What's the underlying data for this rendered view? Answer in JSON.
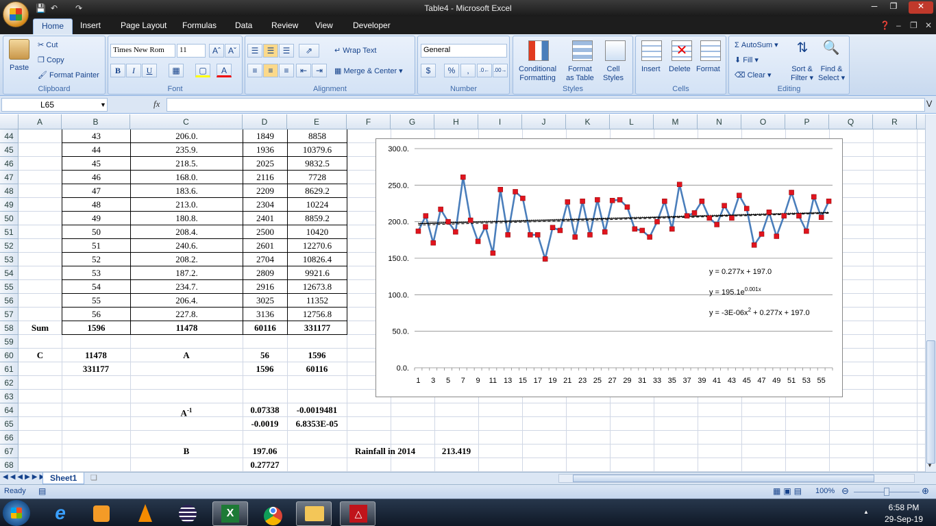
{
  "window": {
    "title": "Table4 - Microsoft Excel"
  },
  "tabs": [
    "Home",
    "Insert",
    "Page Layout",
    "Formulas",
    "Data",
    "Review",
    "View",
    "Developer"
  ],
  "active_tab": "Home",
  "ribbon": {
    "clipboard": {
      "label": "Clipboard",
      "paste": "Paste",
      "cut": "Cut",
      "copy": "Copy",
      "format_painter": "Format Painter"
    },
    "font": {
      "label": "Font",
      "font_name": "Times New Rom",
      "font_size": "11",
      "bold": "B",
      "italic": "I",
      "underline": "U"
    },
    "alignment": {
      "label": "Alignment",
      "wrap_text": "Wrap Text",
      "merge_center": "Merge & Center"
    },
    "number": {
      "label": "Number",
      "format": "General",
      "currency": "$",
      "percent": "%",
      "comma": ","
    },
    "styles": {
      "label": "Styles",
      "conditional": "Conditional",
      "formatting": "Formatting",
      "format_as": "Format",
      "as_table": "as Table",
      "cell": "Cell",
      "cell_styles": "Styles"
    },
    "cells": {
      "label": "Cells",
      "insert": "Insert",
      "delete": "Delete",
      "format": "Format"
    },
    "editing": {
      "label": "Editing",
      "autosum": "AutoSum",
      "fill": "Fill",
      "clear": "Clear",
      "sort": "Sort &",
      "filter": "Filter",
      "find": "Find &",
      "select": "Select"
    }
  },
  "formula_bar": {
    "name_box": "L65",
    "fx": "fx",
    "content": ""
  },
  "columns": [
    "A",
    "B",
    "C",
    "D",
    "E",
    "F",
    "G",
    "H",
    "I",
    "J",
    "K",
    "L",
    "M",
    "N",
    "O",
    "P",
    "Q",
    "R"
  ],
  "rows": [
    "44",
    "45",
    "46",
    "47",
    "48",
    "49",
    "50",
    "51",
    "52",
    "53",
    "54",
    "55",
    "56",
    "57",
    "58",
    "59",
    "60",
    "61",
    "62",
    "63",
    "64",
    "65",
    "66",
    "67",
    "68"
  ],
  "table_rows": [
    {
      "b": "43",
      "c": "206.0.",
      "d": "1849",
      "e": "8858"
    },
    {
      "b": "44",
      "c": "235.9.",
      "d": "1936",
      "e": "10379.6"
    },
    {
      "b": "45",
      "c": "218.5.",
      "d": "2025",
      "e": "9832.5"
    },
    {
      "b": "46",
      "c": "168.0.",
      "d": "2116",
      "e": "7728"
    },
    {
      "b": "47",
      "c": "183.6.",
      "d": "2209",
      "e": "8629.2"
    },
    {
      "b": "48",
      "c": "213.0.",
      "d": "2304",
      "e": "10224"
    },
    {
      "b": "49",
      "c": "180.8.",
      "d": "2401",
      "e": "8859.2"
    },
    {
      "b": "50",
      "c": "208.4.",
      "d": "2500",
      "e": "10420"
    },
    {
      "b": "51",
      "c": "240.6.",
      "d": "2601",
      "e": "12270.6"
    },
    {
      "b": "52",
      "c": "208.2.",
      "d": "2704",
      "e": "10826.4"
    },
    {
      "b": "53",
      "c": "187.2.",
      "d": "2809",
      "e": "9921.6"
    },
    {
      "b": "54",
      "c": "234.7.",
      "d": "2916",
      "e": "12673.8"
    },
    {
      "b": "55",
      "c": "206.4.",
      "d": "3025",
      "e": "11352"
    },
    {
      "b": "56",
      "c": "227.8.",
      "d": "3136",
      "e": "12756.8"
    }
  ],
  "sum_row": {
    "a": "Sum",
    "b": "1596",
    "c": "11478",
    "d": "60116",
    "e": "331177"
  },
  "row60": {
    "a": "C",
    "b": "11478",
    "c": "A",
    "d": "56",
    "e": "1596"
  },
  "row61": {
    "b": "331177",
    "d": "1596",
    "e": "60116"
  },
  "row64": {
    "c": "A",
    "c_sup": "-1",
    "d": "0.07338",
    "e": "-0.0019481"
  },
  "row65": {
    "d": "-0.0019",
    "e": "6.8353E-05"
  },
  "row67": {
    "c": "B",
    "d": "197.06",
    "f": "Rainfall in 2014",
    "h": "213.419"
  },
  "row68": {
    "d": "0.27727"
  },
  "sheet_tab": "Sheet1",
  "status": {
    "ready": "Ready",
    "zoom": "100%"
  },
  "taskbar": {
    "time": "6:58 PM",
    "date": "29-Sep-19"
  },
  "chart_data": {
    "type": "line",
    "x": [
      1,
      2,
      3,
      4,
      5,
      6,
      7,
      8,
      9,
      10,
      11,
      12,
      13,
      14,
      15,
      16,
      17,
      18,
      19,
      20,
      21,
      22,
      23,
      24,
      25,
      26,
      27,
      28,
      29,
      30,
      31,
      32,
      33,
      34,
      35,
      36,
      37,
      38,
      39,
      40,
      41,
      42,
      43,
      44,
      45,
      46,
      47,
      48,
      49,
      50,
      51,
      52,
      53,
      54,
      55,
      56
    ],
    "x_tick_labels": [
      "1",
      "3",
      "5",
      "7",
      "9",
      "11",
      "13",
      "15",
      "17",
      "19",
      "21",
      "23",
      "25",
      "27",
      "29",
      "31",
      "33",
      "35",
      "37",
      "39",
      "41",
      "43",
      "45",
      "47",
      "49",
      "51",
      "53",
      "55"
    ],
    "series": [
      {
        "values": [
          187,
          208,
          171,
          217,
          200,
          186,
          261,
          202,
          173,
          193,
          157,
          244,
          182,
          241,
          232,
          182,
          182,
          149,
          192,
          188,
          227,
          179,
          228,
          182,
          230,
          186,
          229,
          230,
          220,
          190,
          188,
          179,
          200,
          228,
          190,
          251,
          208,
          212,
          228,
          205,
          196,
          222,
          205,
          236,
          218,
          168,
          183,
          213,
          180,
          208,
          240,
          208,
          187,
          234,
          206,
          228
        ]
      }
    ],
    "trendlines": [
      {
        "label": "y = 0.277x + 197.0",
        "style": "solid"
      },
      {
        "label": "y = 195.1e0.001x",
        "style": "dashed"
      },
      {
        "label": "y = -3E-06x2 + 0.277x + 197.0",
        "style": "dotted"
      }
    ],
    "y_tick_labels": [
      "0.0.",
      "50.0.",
      "100.0.",
      "150.0.",
      "200.0.",
      "250.0.",
      "300.0."
    ],
    "ylim": [
      0,
      300
    ],
    "grid": true,
    "colors": {
      "line": "#4a7ebb",
      "marker": "#e0141e",
      "trend": "#000000"
    }
  }
}
